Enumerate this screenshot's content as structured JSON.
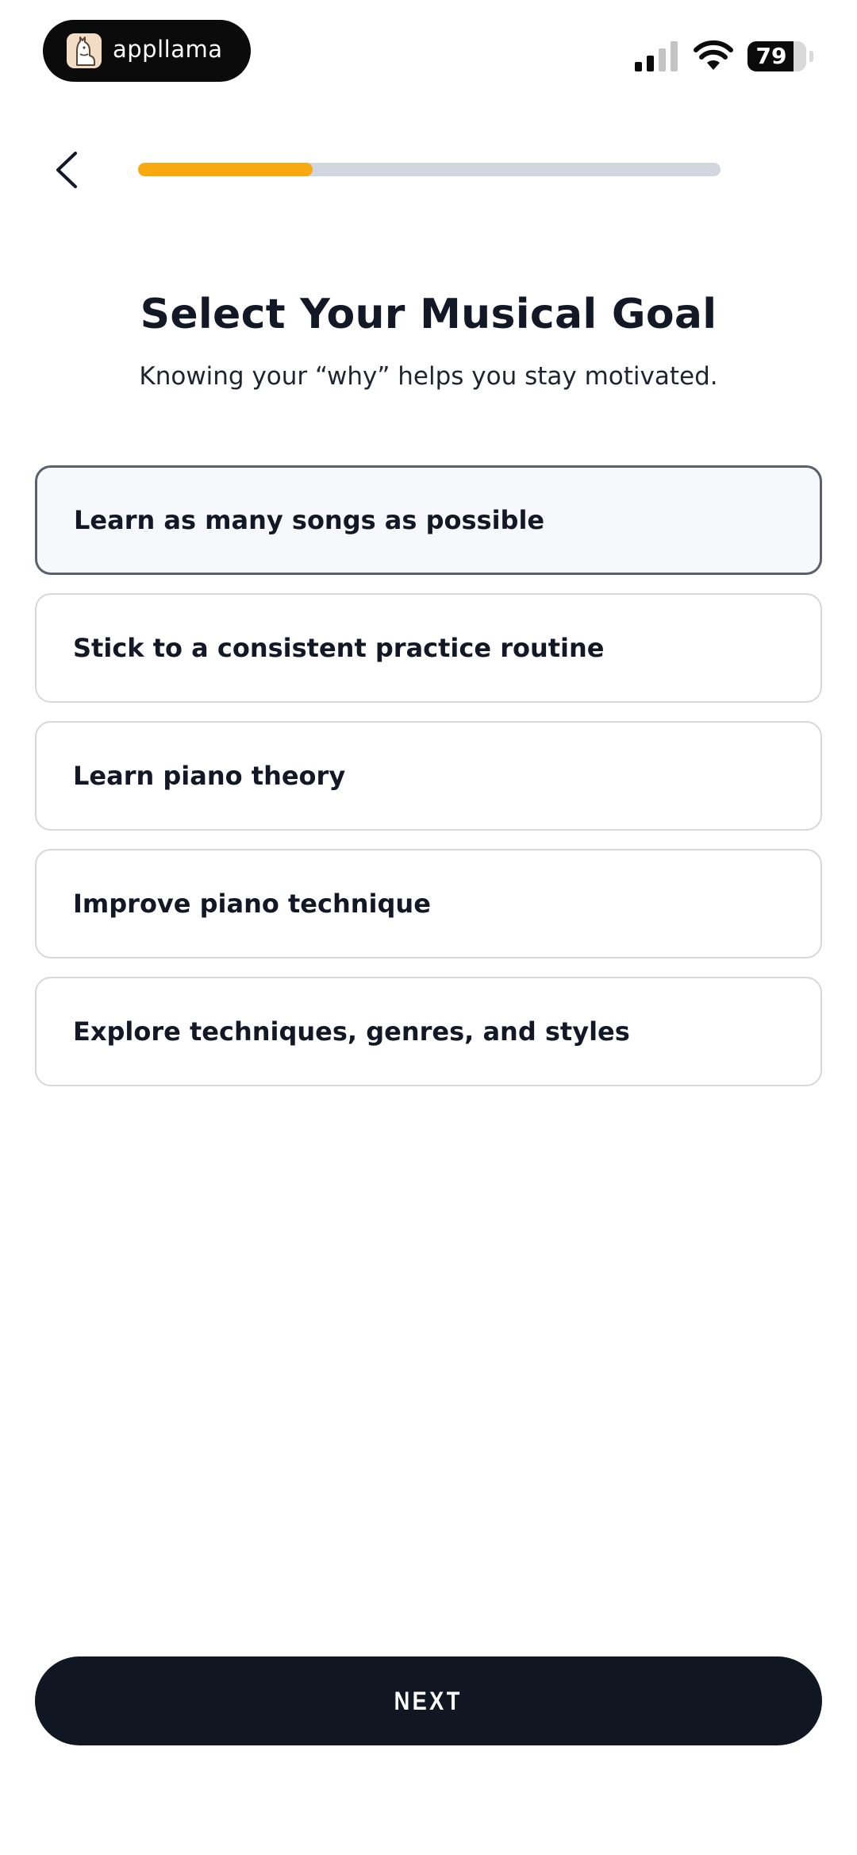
{
  "status_bar": {
    "app_name": "appllama",
    "battery_level": "79",
    "battery_percent": 79,
    "icons": [
      "llama-logo-icon",
      "cellular-signal-icon",
      "wifi-icon",
      "battery-icon"
    ]
  },
  "header": {
    "back_icon": "chevron-left-icon",
    "progress": 0.3
  },
  "content": {
    "title": "Select Your Musical Goal",
    "subtitle": "Knowing your “why” helps you stay motivated.",
    "options": [
      {
        "label": "Learn as many songs as possible",
        "selected": true
      },
      {
        "label": "Stick to a consistent practice routine",
        "selected": false
      },
      {
        "label": "Learn piano theory",
        "selected": false
      },
      {
        "label": "Improve piano technique",
        "selected": false
      },
      {
        "label": "Explore techniques, genres, and styles",
        "selected": false
      }
    ]
  },
  "footer": {
    "next_label": "NEXT"
  },
  "colors": {
    "accent": "#f8a90d",
    "primary_dark": "#111722",
    "track": "#d2d6df"
  }
}
